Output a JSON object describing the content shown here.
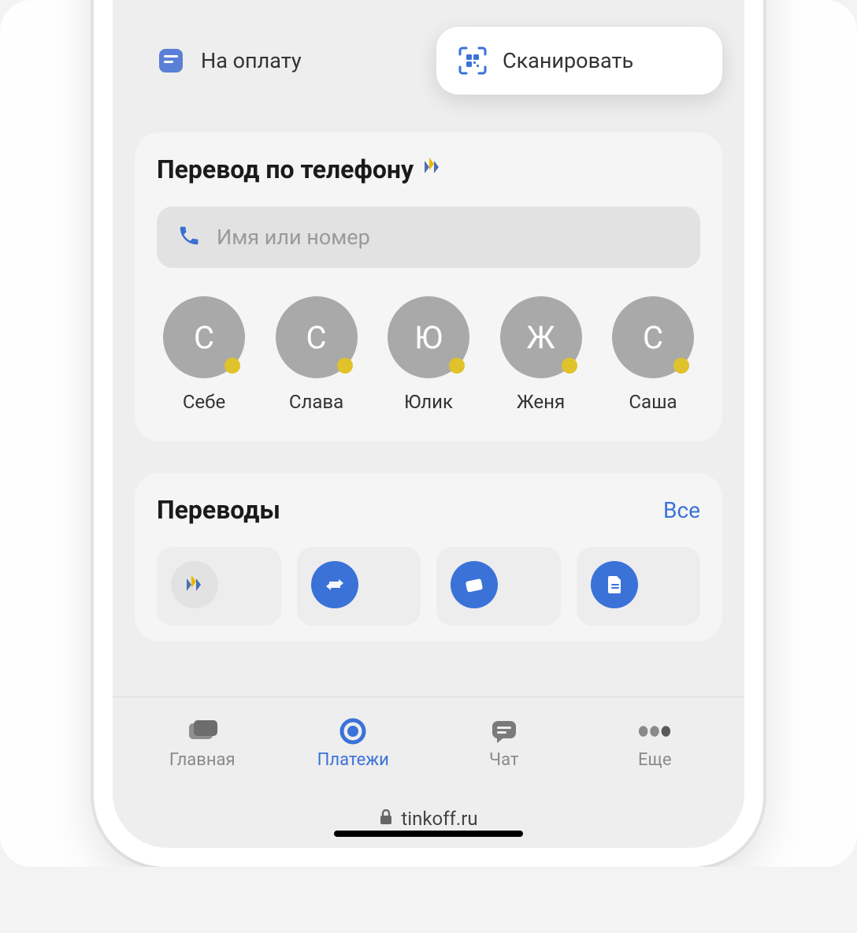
{
  "chips": {
    "pay": "На оплату",
    "scan": "Сканировать"
  },
  "phoneTransfer": {
    "title": "Перевод по телефону",
    "placeholder": "Имя или номер",
    "contacts": [
      {
        "initial": "С",
        "name": "Себе"
      },
      {
        "initial": "С",
        "name": "Слава"
      },
      {
        "initial": "Ю",
        "name": "Юлик"
      },
      {
        "initial": "Ж",
        "name": "Женя"
      },
      {
        "initial": "С",
        "name": "Саша"
      }
    ]
  },
  "transfers": {
    "title": "Переводы",
    "all": "Все"
  },
  "tabs": {
    "home": "Главная",
    "payments": "Платежи",
    "chat": "Чат",
    "more": "Еще"
  },
  "browser": {
    "url": "tinkoff.ru"
  }
}
